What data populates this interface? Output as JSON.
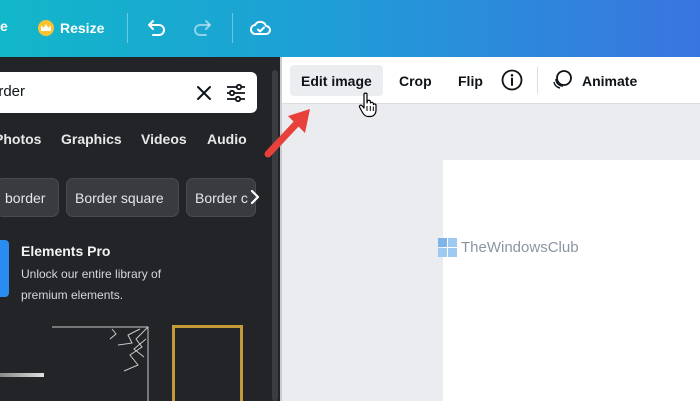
{
  "topbar": {
    "edge_text": "e",
    "resize_label": "Resize",
    "icons": [
      "undo-icon",
      "redo-icon",
      "cloud-saved-icon",
      "crown-icon"
    ]
  },
  "sidebar": {
    "search": {
      "value": "order"
    },
    "tabs": [
      "Photos",
      "Graphics",
      "Videos",
      "Audio"
    ],
    "chips": [
      "border",
      "Border square",
      "Border c"
    ],
    "pro": {
      "title": "Elements Pro",
      "description": "Unlock our entire library of premium elements."
    }
  },
  "toolbar": {
    "edit_image": "Edit image",
    "crop": "Crop",
    "flip": "Flip",
    "animate": "Animate",
    "icons": [
      "info-icon",
      "animate-icon"
    ]
  },
  "canvas": {
    "watermark": "TheWindowsClub"
  },
  "colors": {
    "topbar_start": "#12b7c9",
    "topbar_end": "#3a74e0",
    "panel_bg": "#232428",
    "pro_accent": "#2a8cf0",
    "arrow": "#e8413b"
  }
}
